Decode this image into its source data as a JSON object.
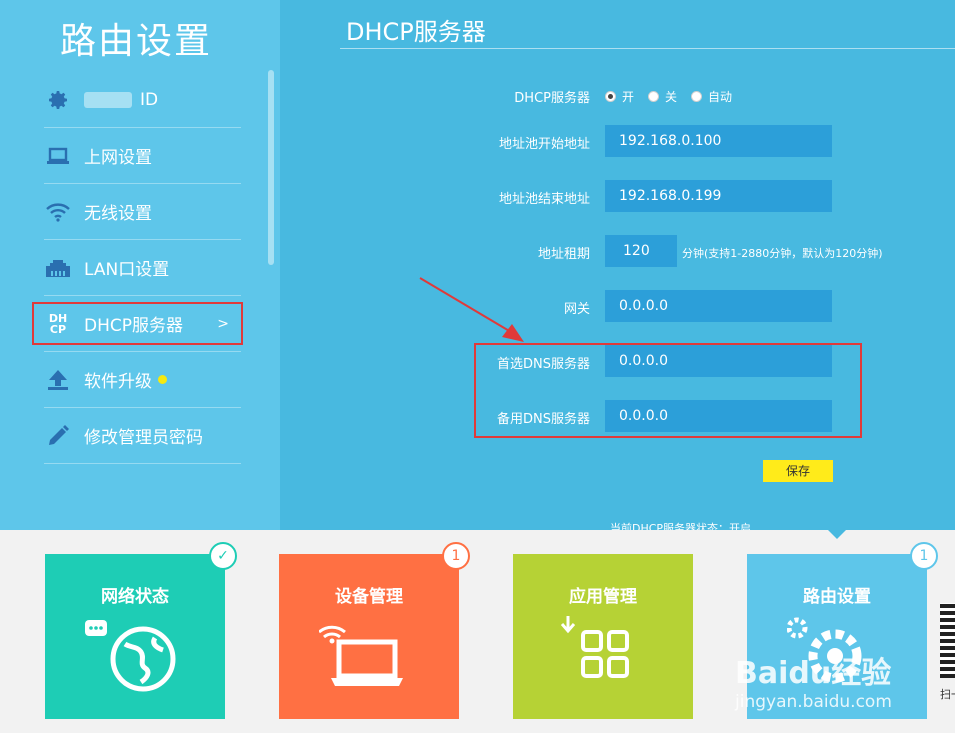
{
  "sidebar": {
    "title": "路由设置",
    "items": [
      {
        "label": "ID",
        "icon": "gear-icon"
      },
      {
        "label": "上网设置",
        "icon": "laptop-icon"
      },
      {
        "label": "无线设置",
        "icon": "wifi-icon"
      },
      {
        "label": "LAN口设置",
        "icon": "lan-port-icon"
      },
      {
        "label": "DHCP服务器",
        "icon": "dhcp-icon",
        "icon_text_top": "DH",
        "icon_text_bottom": "CP",
        "chevron": ">"
      },
      {
        "label": "软件升级",
        "icon": "upload-icon"
      },
      {
        "label": "修改管理员密码",
        "icon": "pencil-icon"
      }
    ]
  },
  "main": {
    "title": "DHCP服务器",
    "dhcp_label": "DHCP服务器",
    "radio_options": [
      "开",
      "关",
      "自动"
    ],
    "radio_selected": "开",
    "pool_start_label": "地址池开始地址",
    "pool_start_value": "192.168.0.100",
    "pool_end_label": "地址池结束地址",
    "pool_end_value": "192.168.0.199",
    "lease_label": "地址租期",
    "lease_value": "120",
    "lease_hint": "分钟(支持1-2880分钟，默认为120分钟)",
    "gateway_label": "网关",
    "gateway_value": "0.0.0.0",
    "dns1_label": "首选DNS服务器",
    "dns1_value": "0.0.0.0",
    "dns2_label": "备用DNS服务器",
    "dns2_value": "0.0.0.0",
    "save_label": "保存",
    "status_text": "当前DHCP服务器状态：开启"
  },
  "tiles": [
    {
      "label": "网络状态",
      "color": "#1ecdb5",
      "badge": "✓"
    },
    {
      "label": "设备管理",
      "color": "#ff7043",
      "badge": "1"
    },
    {
      "label": "应用管理",
      "color": "#b6d235",
      "badge": ""
    },
    {
      "label": "路由设置",
      "color": "#5ec6ea",
      "badge": "1"
    }
  ],
  "qr_text": "扫一扫 管理",
  "watermark": {
    "logo": "Baidu经验",
    "url": "jingyan.baidu.com"
  },
  "colors": {
    "highlight": "#e03a3a",
    "save": "#ffeb1a",
    "input": "#2c9fd9"
  }
}
